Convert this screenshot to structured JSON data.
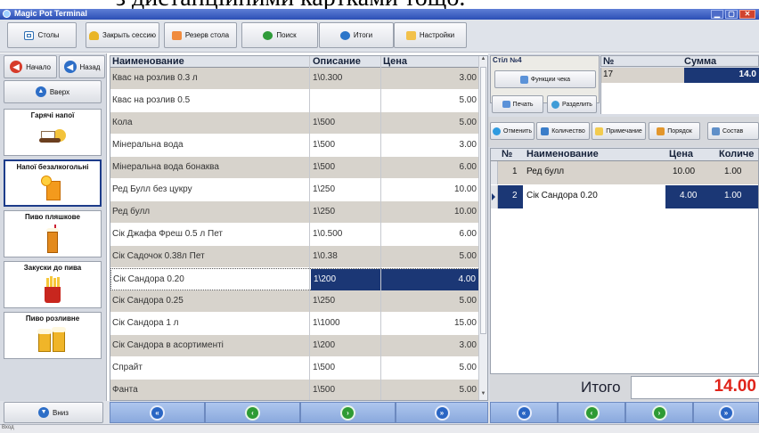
{
  "top_fragment": "з дистанційними картками тощо.",
  "window": {
    "title": "Magic Pot Terminal",
    "btn_min": "▁",
    "btn_max": "▢",
    "btn_close": "✕"
  },
  "toolbar": {
    "tables": "Столы",
    "close_session": "Закрыть сессию",
    "reserve": "Резерв стола",
    "search": "Поиск",
    "totals": "Итоги",
    "settings": "Настройки"
  },
  "nav": {
    "home": "Начало",
    "back": "Назад",
    "up": "Вверх",
    "down": "Вниз"
  },
  "categories": [
    {
      "label": "Гарячі напої",
      "icon": "coffee-icon"
    },
    {
      "label": "Напої безалкогольні",
      "icon": "juice-icon"
    },
    {
      "label": "Пиво пляшкове",
      "icon": "bottle-beer-icon"
    },
    {
      "label": "Закуски до пива",
      "icon": "fries-icon"
    },
    {
      "label": "Пиво розливне",
      "icon": "draft-beer-icon"
    }
  ],
  "products": {
    "headers": {
      "name": "Наименование",
      "desc": "Описание",
      "price": "Цена"
    },
    "rows": [
      {
        "name": "Квас на розлив 0.3 л",
        "desc": "1\\0.300",
        "price": "3.00"
      },
      {
        "name": "Квас на розлив 0.5",
        "desc": "",
        "price": "5.00"
      },
      {
        "name": "Кола",
        "desc": "1\\500",
        "price": "5.00"
      },
      {
        "name": "Мінеральна вода",
        "desc": "1\\500",
        "price": "3.00"
      },
      {
        "name": "Мінеральна вода бонаква",
        "desc": "1\\500",
        "price": "6.00"
      },
      {
        "name": "Ред Булл без цукру",
        "desc": "1\\250",
        "price": "10.00"
      },
      {
        "name": "Ред булл",
        "desc": "1\\250",
        "price": "10.00"
      },
      {
        "name": "Сік Джафа Фреш 0.5 л Пет",
        "desc": "1\\0.500",
        "price": "6.00"
      },
      {
        "name": "Сік Садочок 0.38л Пет",
        "desc": "1\\0.38",
        "price": "5.00"
      },
      {
        "name": "Сік Сандора 0.20",
        "desc": "1\\200",
        "price": "4.00"
      },
      {
        "name": "Сік Сандора 0.25",
        "desc": "1\\250",
        "price": "5.00"
      },
      {
        "name": "Сік Сандора 1 л",
        "desc": "1\\1000",
        "price": "15.00"
      },
      {
        "name": "Сік Сандора в асортименті",
        "desc": "1\\200",
        "price": "3.00"
      },
      {
        "name": "Спрайт",
        "desc": "1\\500",
        "price": "5.00"
      },
      {
        "name": "Фанта",
        "desc": "1\\500",
        "price": "5.00"
      }
    ]
  },
  "check": {
    "table_label": "Стіл №4",
    "func_check": "Функции чека",
    "print": "Печать",
    "split": "Разделить",
    "headers": {
      "no": "№",
      "sum": "Сумма"
    },
    "no": "17",
    "sum": "14.0"
  },
  "order_toolbar": {
    "cancel": "Отменить",
    "quantity": "Количество",
    "note": "Примечание",
    "order": "Порядок",
    "composition": "Состав"
  },
  "order": {
    "headers": {
      "no": "№",
      "name": "Наименование",
      "price": "Цена",
      "qty": "Количе"
    },
    "rows": [
      {
        "no": "1",
        "name": "Ред булл",
        "price": "10.00",
        "qty": "1.00"
      },
      {
        "no": "2",
        "name": "Сік Сандора 0.20",
        "price": "4.00",
        "qty": "1.00"
      }
    ]
  },
  "total": {
    "label": "Итого",
    "value": "14.00"
  },
  "status": "Вход"
}
